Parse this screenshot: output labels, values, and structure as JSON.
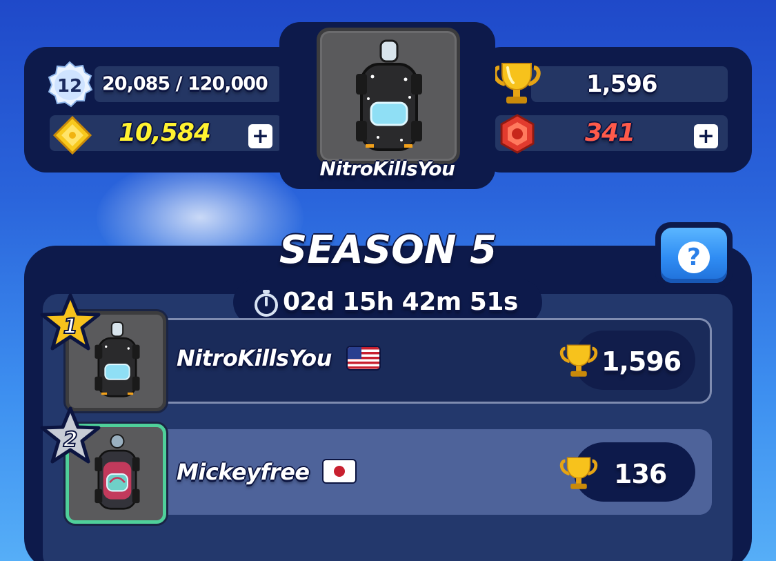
{
  "player": {
    "name": "NitroKillsYou",
    "level": "12",
    "xp": "20,085 / 120,000",
    "coins": "10,584",
    "trophies": "1,596",
    "gems": "341"
  },
  "season": {
    "title": "SEASON 5",
    "timer": "02d 15h 42m 51s",
    "help_label": "?"
  },
  "leaderboard": [
    {
      "rank": "1",
      "name": "NitroKillsYou",
      "flag": "us-flag",
      "trophies": "1,596"
    },
    {
      "rank": "2",
      "name": "Mickeyfree",
      "flag": "jp-flag",
      "trophies": "136"
    }
  ],
  "buttons": {
    "plus_label": "+"
  },
  "colors": {
    "panel": "#0d1a4b",
    "coins": "#fff230",
    "gems": "#ff5a4a",
    "gold_star": "#f7c21c",
    "silver_star": "#c7ccd6",
    "help_button": "#2f8cf3"
  }
}
